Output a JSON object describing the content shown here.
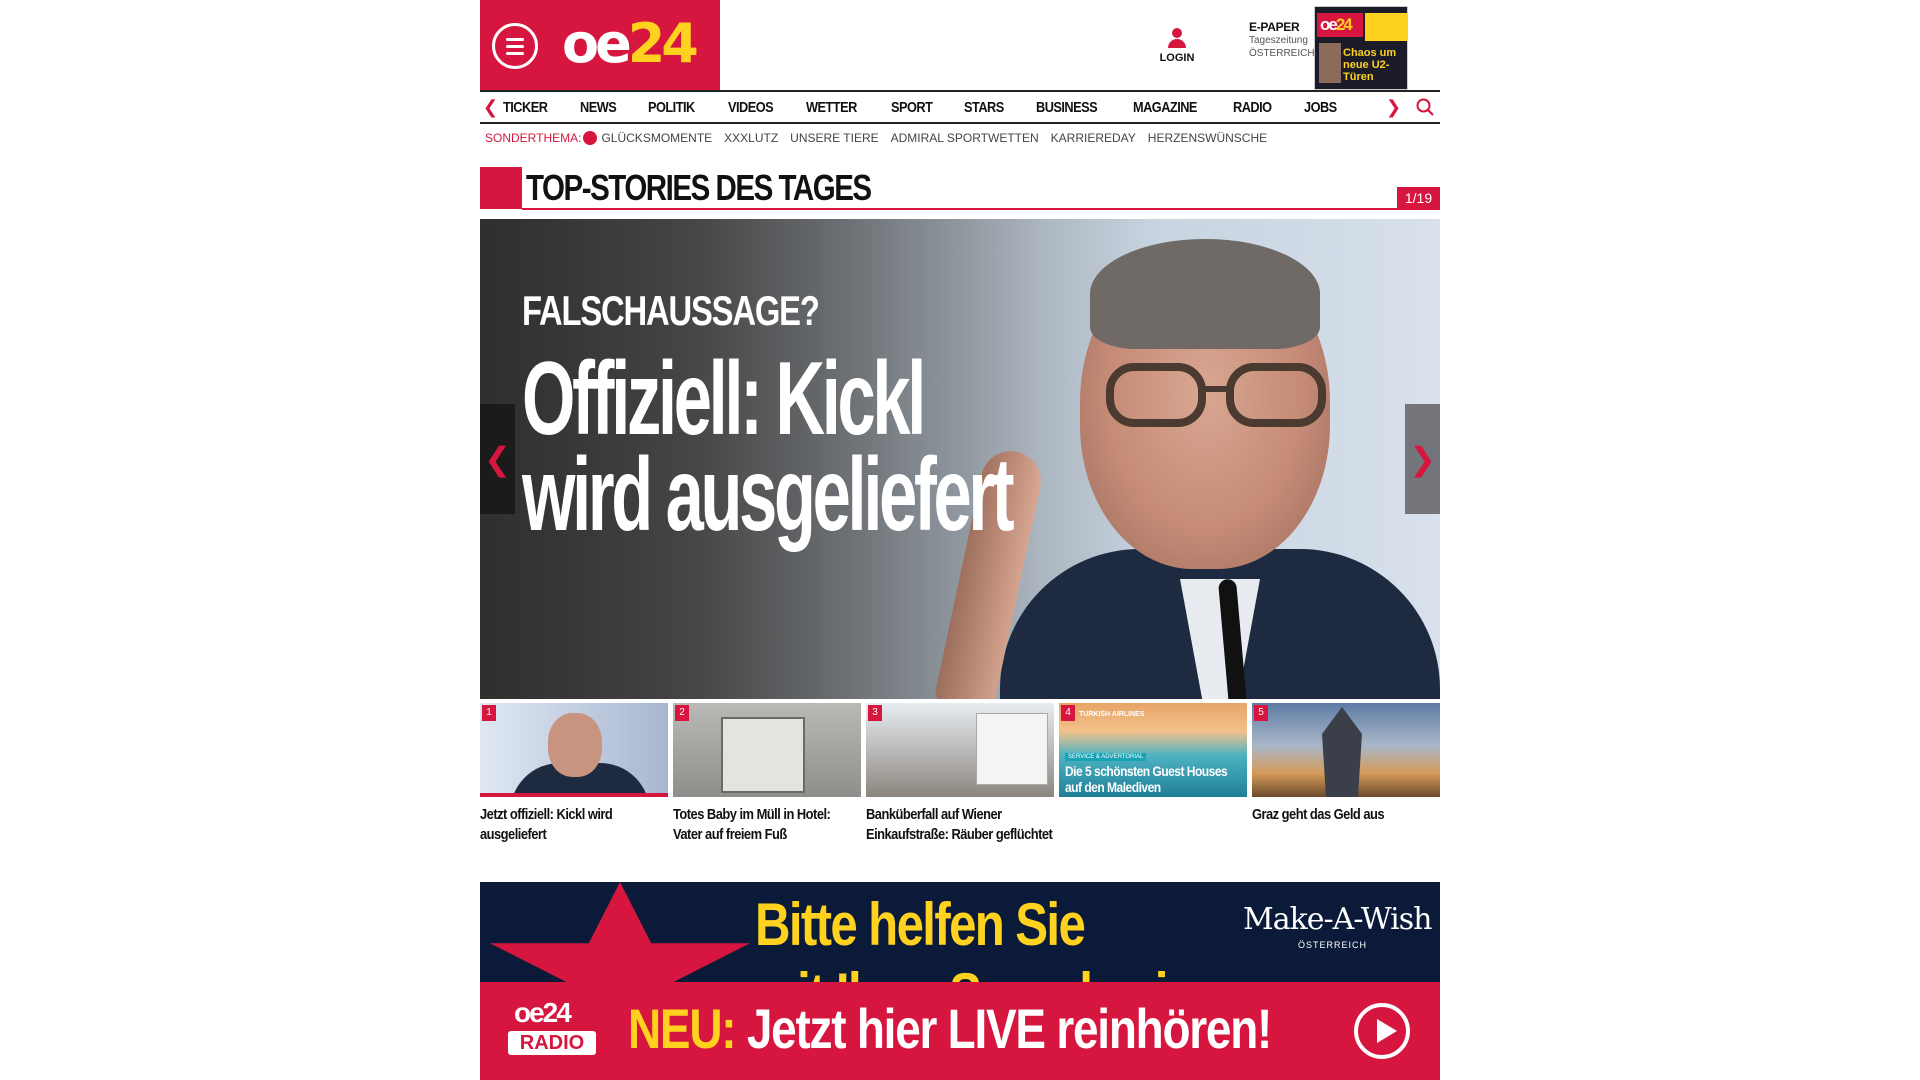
{
  "header": {
    "logo_oe": "oe",
    "logo_24": "24",
    "login_label": "LOGIN",
    "epaper_title": "E-PAPER",
    "epaper_sub1": "Tageszeitung",
    "epaper_sub2": "ÖSTERREICH",
    "epaper_cover_headline": "Chaos um neue U2-Türen"
  },
  "nav": {
    "items": [
      "TICKER",
      "NEWS",
      "POLITIK",
      "VIDEOS",
      "WETTER",
      "SPORT",
      "STARS",
      "BUSINESS",
      "MAGAZINE",
      "RADIO",
      "JOBS"
    ]
  },
  "special": {
    "label": "SONDERTHEMA:",
    "items": [
      "GLÜCKSMOMENTE",
      "XXXLUTZ",
      "UNSERE TIERE",
      "ADMIRAL SPORTWETTEN",
      "KARRIEREDAY",
      "HERZENSWÜNSCHE"
    ]
  },
  "top_stories": {
    "title": "TOP-STORIES DES TAGES",
    "counter": "1/19"
  },
  "hero": {
    "kicker": "FALSCHAUSSAGE?",
    "headline": "Offiziell: Kickl wird ausgeliefert"
  },
  "thumbs": [
    {
      "num": "1",
      "caption": "Jetzt offiziell: Kickl wird ausgeliefert"
    },
    {
      "num": "2",
      "caption": "Totes Baby im Müll in Hotel: Vater auf freiem Fuß"
    },
    {
      "num": "3",
      "caption": "Banküberfall auf Wiener Einkaufstraße: Räuber geflüchtet"
    },
    {
      "num": "4",
      "caption": "",
      "overlay": "Die 5 schönsten Guest Houses auf den Malediven",
      "ad_tag": "SERVICE & ADVERTORIAL",
      "brand": "TURKISH AIRLINES"
    },
    {
      "num": "5",
      "caption": "Graz geht das Geld aus"
    }
  ],
  "banner": {
    "line1": "Bitte helfen Sie",
    "line2": "mit Ihrer Spende einem",
    "brand": "Make-A-Wish",
    "brand_sub": "ÖSTERREICH"
  },
  "radio": {
    "logo_top": "oe24",
    "logo_bottom": "RADIO",
    "neu": "NEU:",
    "message": "Jetzt hier LIVE reinhören!"
  },
  "colors": {
    "brand_red": "#d6163f",
    "brand_yellow": "#ffd21f",
    "text_dark": "#111111"
  }
}
